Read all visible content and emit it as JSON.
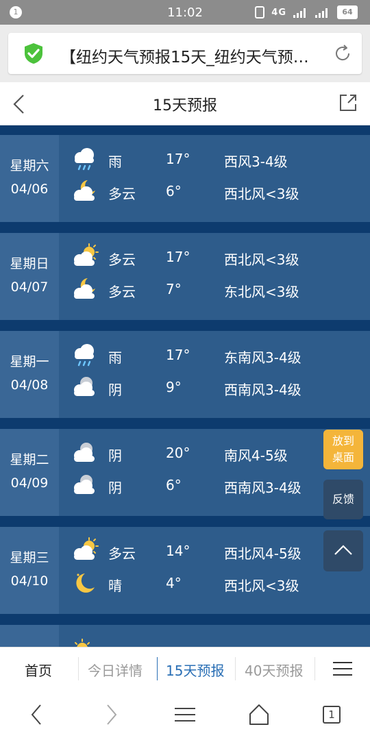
{
  "status_bar": {
    "notification_count": "1",
    "time": "11:02",
    "signal_label": "4G",
    "battery": "64"
  },
  "address_bar": {
    "page_title": "【纽约天气预报15天_纽约天气预…"
  },
  "top_nav": {
    "title": "15天预报"
  },
  "days": [
    {
      "weekday": "星期六",
      "date": "04/06",
      "day": {
        "icon": "rain-cloud-icon",
        "cond": "雨",
        "temp": "17°",
        "wind": "西风3-4级"
      },
      "night": {
        "icon": "moon-cloud-icon",
        "cond": "多云",
        "temp": "6°",
        "wind": "西北风<3级"
      }
    },
    {
      "weekday": "星期日",
      "date": "04/07",
      "day": {
        "icon": "sun-cloud-icon",
        "cond": "多云",
        "temp": "17°",
        "wind": "西北风<3级"
      },
      "night": {
        "icon": "moon-cloud-icon",
        "cond": "多云",
        "temp": "7°",
        "wind": "东北风<3级"
      }
    },
    {
      "weekday": "星期一",
      "date": "04/08",
      "day": {
        "icon": "rain-cloud-icon",
        "cond": "雨",
        "temp": "17°",
        "wind": "东南风3-4级"
      },
      "night": {
        "icon": "overcast-cloud-icon",
        "cond": "阴",
        "temp": "9°",
        "wind": "西南风3-4级"
      }
    },
    {
      "weekday": "星期二",
      "date": "04/09",
      "day": {
        "icon": "overcast-cloud-icon",
        "cond": "阴",
        "temp": "20°",
        "wind": "南风4-5级"
      },
      "night": {
        "icon": "overcast-cloud-icon",
        "cond": "阴",
        "temp": "6°",
        "wind": "西南风3-4级"
      }
    },
    {
      "weekday": "星期三",
      "date": "04/10",
      "day": {
        "icon": "sun-cloud-icon",
        "cond": "多云",
        "temp": "14°",
        "wind": "西北风4-5级"
      },
      "night": {
        "icon": "crescent-moon-icon",
        "cond": "晴",
        "temp": "4°",
        "wind": "西北风<3级"
      }
    }
  ],
  "float_buttons": {
    "add_desktop_line1": "放到",
    "add_desktop_line2": "桌面",
    "feedback": "反馈"
  },
  "bottom_nav": {
    "home": "首页",
    "today": "今日详情",
    "fifteen": "15天预报",
    "forty": "40天预报"
  },
  "system_bar": {
    "tab_count": "1"
  },
  "colors": {
    "page_bg": "#0d3b6e",
    "row_bg": "#2e5c8b",
    "date_col_bg": "#3a6796",
    "active_tab": "#2a6fb5",
    "desktop_button": "#f4b53a",
    "shield_green": "#4cc23c"
  }
}
